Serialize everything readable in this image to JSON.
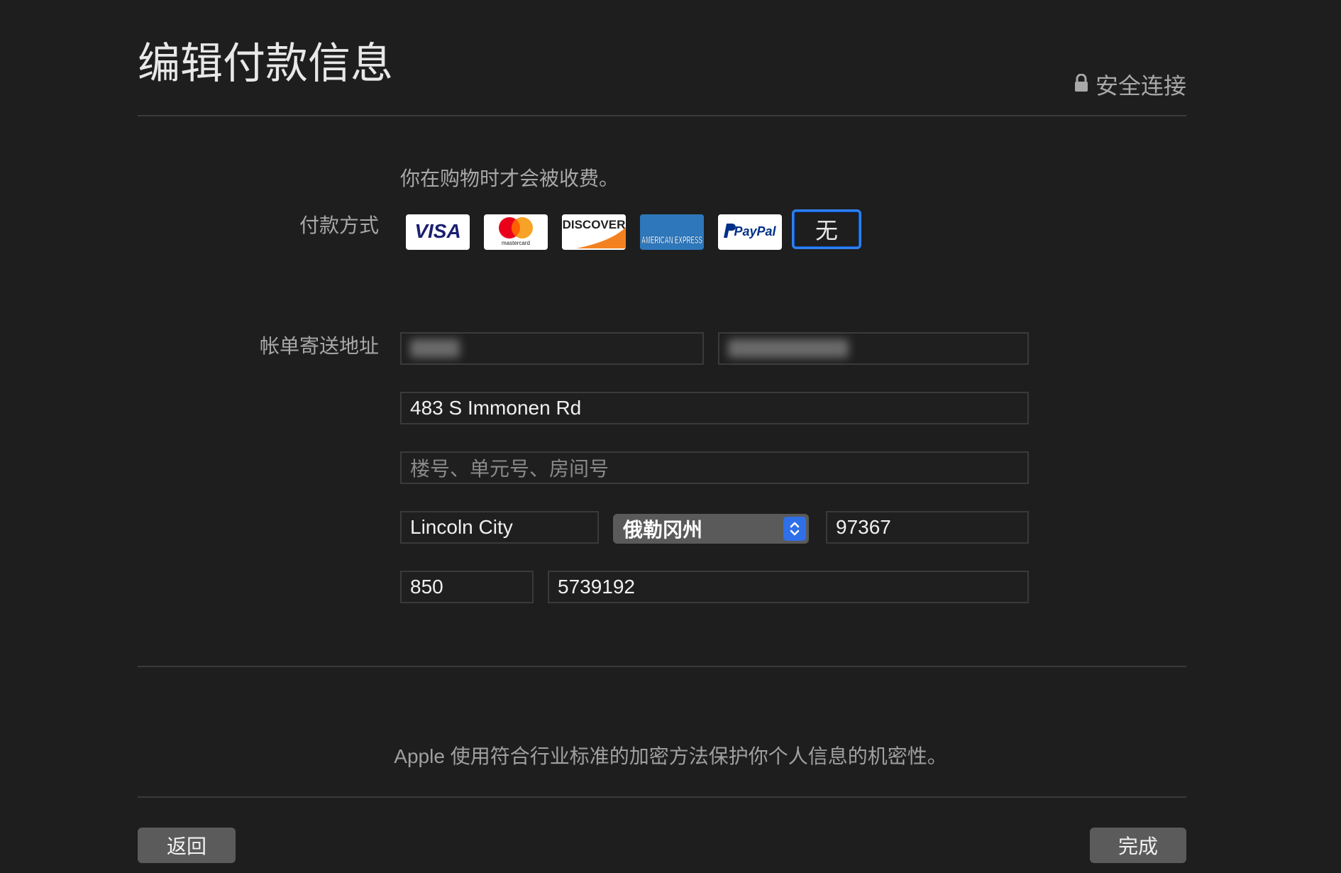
{
  "header": {
    "title": "编辑付款信息",
    "secure_label": "安全连接",
    "lock_icon": "lock-icon"
  },
  "payment": {
    "note": "你在购物时才会被收费。",
    "label": "付款方式",
    "methods": [
      {
        "name": "VISA",
        "icon": "visa-icon"
      },
      {
        "name": "mastercard",
        "icon": "mastercard-icon"
      },
      {
        "name": "DISCOVER",
        "icon": "discover-icon"
      },
      {
        "name": "AMERICAN EXPRESS",
        "icon": "amex-icon"
      },
      {
        "name": "PayPal",
        "icon": "paypal-icon"
      },
      {
        "name": "无",
        "selected": true
      }
    ]
  },
  "billing": {
    "label": "帐单寄送地址",
    "street": "483 S Immonen Rd",
    "unit_placeholder": "楼号、单元号、房间号",
    "city": "Lincoln City",
    "state": "俄勒冈州",
    "zip": "97367",
    "area_code": "850",
    "phone": "5739192"
  },
  "footer": {
    "privacy_note": "Apple 使用符合行业标准的加密方法保护你个人信息的机密性。",
    "back_label": "返回",
    "done_label": "完成"
  },
  "colors": {
    "background": "#1e1e1e",
    "accent": "#2f7fef"
  }
}
